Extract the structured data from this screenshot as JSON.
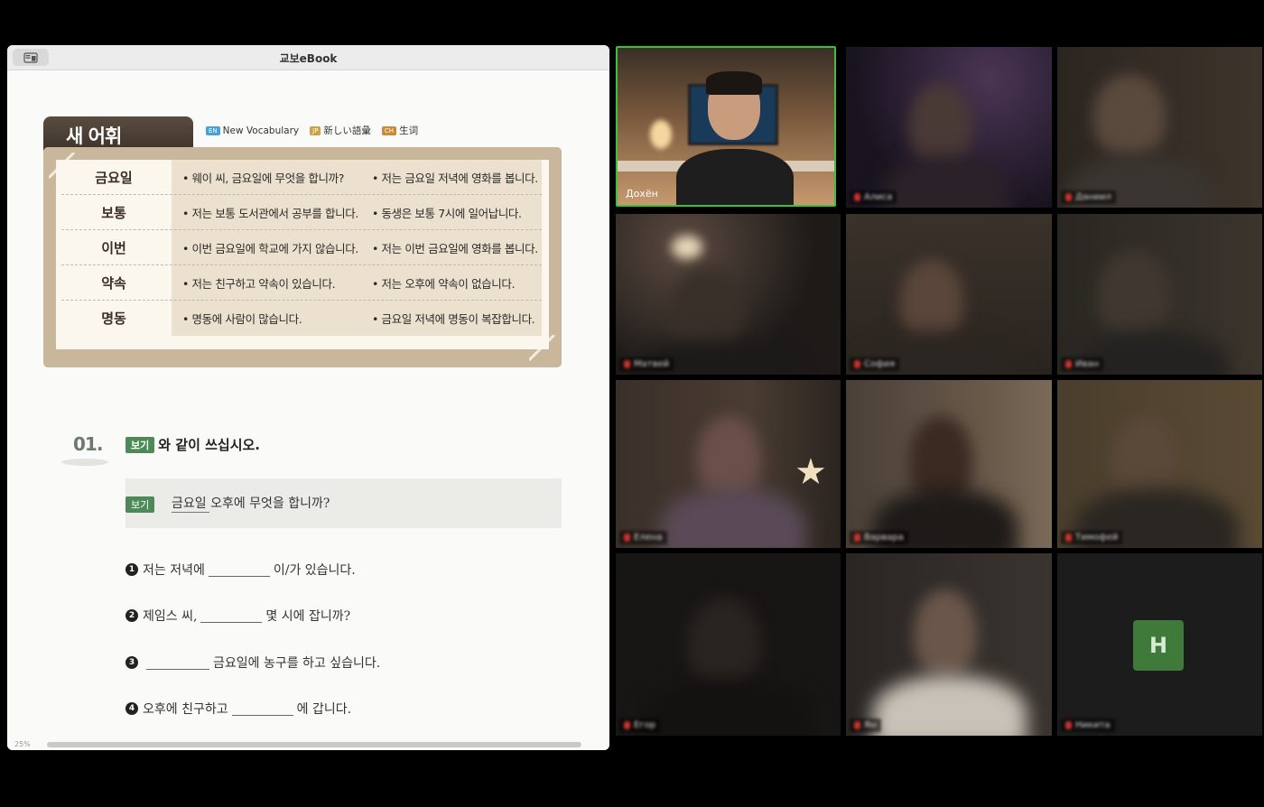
{
  "ebook": {
    "window_title": "교보eBook",
    "zoom": "25%",
    "vocab": {
      "header": "새 어휘",
      "languages": [
        {
          "code": "EN",
          "label": "New Vocabulary",
          "color": "#4a9fd6"
        },
        {
          "code": "JP",
          "label": "新しい語彙",
          "color": "#c9a347"
        },
        {
          "code": "CH",
          "label": "生词",
          "color": "#c98a3c"
        }
      ],
      "rows": [
        {
          "word": "금요일",
          "ex1": "• 웨이 씨, 금요일에 무엇을 합니까?",
          "ex2": "• 저는 금요일 저녁에 영화를 봅니다."
        },
        {
          "word": "보통",
          "ex1": "• 저는 보통 도서관에서 공부를 합니다.",
          "ex2": "• 동생은 보통 7시에 일어납니다."
        },
        {
          "word": "이번",
          "ex1": "• 이번 금요일에 학교에 가지 않습니다.",
          "ex2": "• 저는 이번 금요일에 영화를 봅니다."
        },
        {
          "word": "약속",
          "ex1": "• 저는 친구하고 약속이 있습니다.",
          "ex2": "• 저는 오후에 약속이 없습니다."
        },
        {
          "word": "명동",
          "ex1": "• 명동에 사람이 많습니다.",
          "ex2": "• 금요일 저녁에 명동이 복잡합니다."
        }
      ]
    },
    "exercise": {
      "number": "01.",
      "badge": "보기",
      "instruction": "와 같이 쓰십시오.",
      "example": "금요일 오후에 무엇을 합니까?",
      "questions": [
        {
          "num": "1",
          "before": "저는 저녁에",
          "after": "이/가 있습니다."
        },
        {
          "num": "2",
          "before": "제임스 씨,",
          "after": "몇 시에 잡니까?"
        },
        {
          "num": "3",
          "before": "",
          "after": "금요일에 농구를 하고 싶습니다."
        },
        {
          "num": "4",
          "before": "오후에 친구하고",
          "after": "에 갑니다."
        }
      ]
    }
  },
  "video_call": {
    "host_name": "Дохён",
    "participants": [
      "Алиса",
      "Даниил",
      "Матвей",
      "София",
      "Иван",
      "Елена",
      "Варвара",
      "Тимофей",
      "Егор",
      "Ян",
      "Никита"
    ],
    "avatar_letter": "H",
    "avatar_color": "#3f7a3a",
    "active_speaker_color": "#3ebf3e"
  }
}
